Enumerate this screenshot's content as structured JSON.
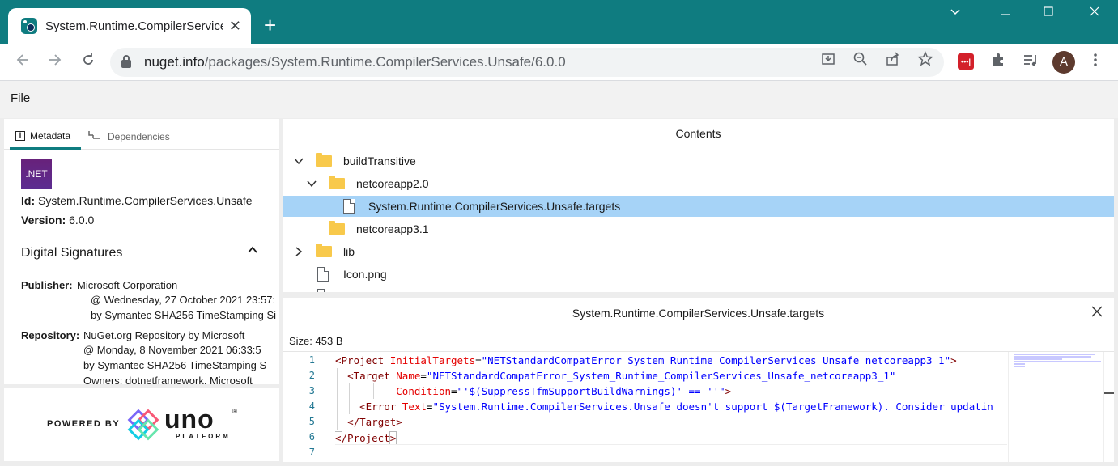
{
  "browser": {
    "tab_title": "System.Runtime.CompilerServices.Unsafe",
    "url_host": "nuget.info",
    "url_path": "/packages/System.Runtime.CompilerServices.Unsafe/6.0.0",
    "profile_initial": "A",
    "accent_color": "#0f7c80"
  },
  "menu": {
    "file_label": "File"
  },
  "left_panel": {
    "tabs": [
      {
        "label": "Metadata",
        "active": true
      },
      {
        "label": "Dependencies",
        "active": false
      }
    ],
    "logo_text": ".NET",
    "id_label": "Id:",
    "id_value": "System.Runtime.CompilerServices.Unsafe",
    "version_label": "Version:",
    "version_value": "6.0.0",
    "signatures_title": "Digital Signatures",
    "publisher_label": "Publisher:",
    "publisher_lines": [
      "Microsoft Corporation",
      "@ Wednesday, 27 October 2021 23:57:",
      "by Symantec SHA256 TimeStamping Si"
    ],
    "repository_label": "Repository:",
    "repository_lines": [
      "NuGet.org Repository by Microsoft",
      "@ Monday, 8 November 2021 06:33:5",
      "by Symantec SHA256 TimeStamping S",
      "Owners:  dotnetframework, Microsoft"
    ]
  },
  "uno": {
    "powered_by": "POWERED BY",
    "word": "uno",
    "sub": "PLATFORM",
    "reg": "®"
  },
  "contents": {
    "title": "Contents",
    "items": [
      {
        "label": "buildTransitive",
        "kind": "folder",
        "expanded": true,
        "depth": 0
      },
      {
        "label": "netcoreapp2.0",
        "kind": "folder",
        "expanded": true,
        "depth": 1
      },
      {
        "label": "System.Runtime.CompilerServices.Unsafe.targets",
        "kind": "file",
        "depth": 2,
        "selected": true
      },
      {
        "label": "netcoreapp3.1",
        "kind": "folder",
        "depth": 1
      },
      {
        "label": "lib",
        "kind": "folder",
        "expanded": false,
        "depth": 0
      },
      {
        "label": "Icon.png",
        "kind": "file",
        "depth": 0
      }
    ]
  },
  "preview": {
    "title": "System.Runtime.CompilerServices.Unsafe.targets",
    "size_text": "Size: 453 B",
    "line_numbers": [
      "1",
      "2",
      "3",
      "4",
      "5",
      "6",
      "7"
    ],
    "code": {
      "l1_open": "<Project ",
      "l1_attr": "InitialTargets",
      "l1_eq": "=",
      "l1_val": "\"NETStandardCompatError_System_Runtime_CompilerServices_Unsafe_netcoreapp3_1\"",
      "l1_close": ">",
      "l2_open": "<Target ",
      "l2_attr": "Name",
      "l2_eq": "=",
      "l2_val": "\"NETStandardCompatError_System_Runtime_CompilerServices_Unsafe_netcoreapp3_1\"",
      "l3_attr": "Condition",
      "l3_eq": "=",
      "l3_val": "\"'$(SuppressTfmSupportBuildWarnings)' == ''\"",
      "l3_close": ">",
      "l4_open": "<Error ",
      "l4_attr": "Text",
      "l4_eq": "=",
      "l4_val": "\"System.Runtime.CompilerServices.Unsafe doesn't support $(TargetFramework). Consider updatin",
      "l5": "</Target>",
      "l6_open": "<",
      "l6_mid": "/Project",
      "l6_close": ">"
    }
  }
}
